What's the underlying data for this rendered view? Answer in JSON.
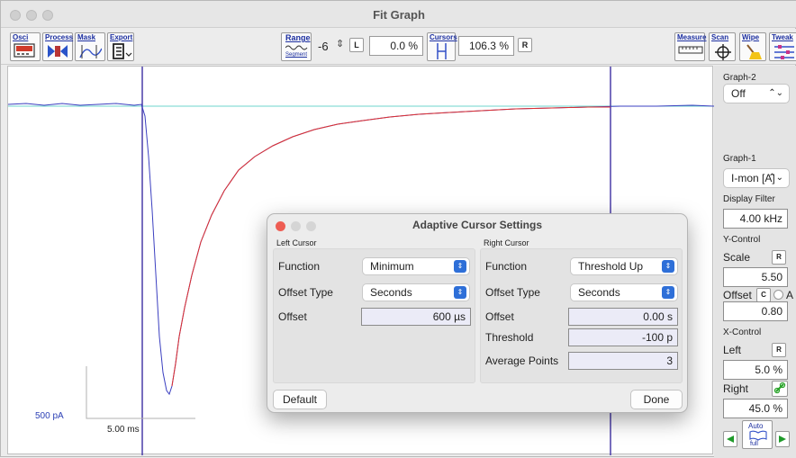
{
  "window": {
    "title": "Fit Graph"
  },
  "toolbar": {
    "osci": "Osci",
    "process": "Process",
    "mask": "Mask",
    "export": "Export",
    "range": "Range",
    "segment": "Segment",
    "range_value": "-6",
    "l_button": "L",
    "left_pct": "0.0 %",
    "cursors": "Cursors",
    "right_pct": "106.3 %",
    "r_button": "R",
    "measure": "Measure",
    "scan": "Scan",
    "wipe": "Wipe",
    "tweak": "Tweak"
  },
  "graph": {
    "scale_y_label": "500 pA",
    "scale_x_label": "5.00 ms",
    "colors": {
      "trace": "#3b3fc0",
      "fit": "#e0302f",
      "baseline": "#6cd4cc",
      "cursor": "#4a3da8"
    }
  },
  "sidebar": {
    "graph2_label": "Graph-2",
    "graph2_value": "Off",
    "graph1_label": "Graph-1",
    "graph1_value": "I-mon [A]",
    "display_filter_label": "Display Filter",
    "display_filter_value": "4.00 kHz",
    "ycontrol_label": "Y-Control",
    "scale_label": "Scale",
    "r_button": "R",
    "scale_value": "5.50",
    "offset_label": "Offset",
    "c_button": "C",
    "a_label": "A",
    "offset_value": "0.80",
    "xcontrol_label": "X-Control",
    "left_label": "Left",
    "left_r": "R",
    "left_value": "5.0 %",
    "right_label": "Right",
    "right_value": "45.0 %",
    "auto_label": "Auto",
    "full_label": "full"
  },
  "dialog": {
    "title": "Adaptive Cursor Settings",
    "left_section": "Left Cursor",
    "right_section": "Right Cursor",
    "left": {
      "function_label": "Function",
      "function_value": "Minimum",
      "offset_type_label": "Offset Type",
      "offset_type_value": "Seconds",
      "offset_label": "Offset",
      "offset_value": "600 µs"
    },
    "right": {
      "function_label": "Function",
      "function_value": "Threshold Up",
      "offset_type_label": "Offset Type",
      "offset_type_value": "Seconds",
      "offset_label": "Offset",
      "offset_value": "0.00 s",
      "threshold_label": "Threshold",
      "threshold_value": "-100 p",
      "avg_points_label": "Average Points",
      "avg_points_value": "3"
    },
    "default_button": "Default",
    "done_button": "Done"
  }
}
